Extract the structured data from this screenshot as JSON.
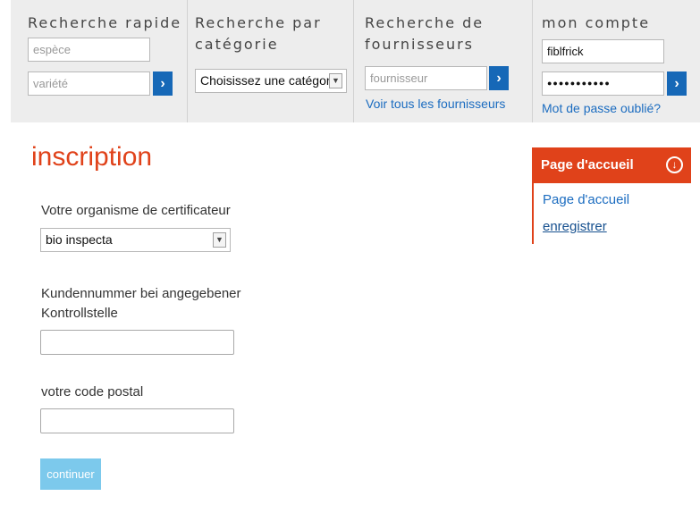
{
  "quick_search": {
    "title": "Recherche rapide",
    "species_placeholder": "espèce",
    "variety_placeholder": "variété"
  },
  "category_search": {
    "title_line1": "Recherche par",
    "title_line2": "catégorie",
    "select_value": "Choisissez une catégorie"
  },
  "supplier_search": {
    "title_line1": "Recherche de",
    "title_line2": "fournisseurs",
    "placeholder": "fournisseur",
    "all_link": "Voir tous les fournisseurs"
  },
  "account": {
    "title": "mon compte",
    "username": "fiblfrick",
    "password_mask": "●●●●●●●●●●●",
    "forgot_link": "Mot de passe oublié?"
  },
  "page": {
    "title": "inscription",
    "cert_label": "Votre organisme de certificateur",
    "cert_value": "bio inspecta",
    "customer_label_line1": "Kundennummer bei angegebener",
    "customer_label_line2": "Kontrollstelle",
    "zip_label": "votre code postal",
    "submit_label": "continuer"
  },
  "sidebar": {
    "header": "Page d'accueil",
    "links": [
      "Page d'accueil",
      "enregistrer"
    ]
  },
  "colors": {
    "accent": "#e0421a",
    "button_blue": "#1668b7",
    "link_blue": "#1b6cc0",
    "submit_blue": "#7cc9ec"
  },
  "icons": {
    "go": "chevron-right-icon",
    "dropdown": "chevron-down-icon",
    "panel_toggle": "circle-arrow-down-icon"
  }
}
